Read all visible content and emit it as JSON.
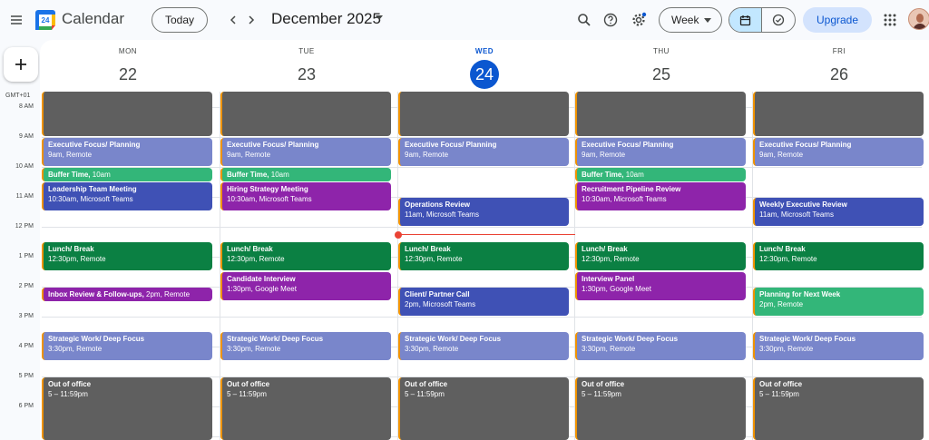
{
  "header": {
    "app_title": "Calendar",
    "logo_text": "24",
    "today_label": "Today",
    "current_date": "December 2025",
    "view_label": "Week",
    "upgrade_label": "Upgrade"
  },
  "icons": {
    "menu": "hamburger-menu-icon",
    "prev": "chevron-left-icon",
    "next": "chevron-right-icon",
    "search": "search-icon",
    "help": "help-icon",
    "settings": "gear-icon",
    "calendar_view": "calendar-icon",
    "tasks": "check-circle-icon",
    "apps": "apps-grid-icon",
    "create": "plus-icon"
  },
  "colors": {
    "accent": "#0b57d0",
    "now_line": "#ea4335",
    "event_border": "#f09300"
  },
  "timezone": "GMT+01",
  "days": [
    {
      "dow": "MON",
      "num": "22"
    },
    {
      "dow": "TUE",
      "num": "23"
    },
    {
      "dow": "WED",
      "num": "24",
      "today": true
    },
    {
      "dow": "THU",
      "num": "25"
    },
    {
      "dow": "FRI",
      "num": "26"
    }
  ],
  "hours": [
    "8 AM",
    "9 AM",
    "10 AM",
    "11 AM",
    "12 PM",
    "1 PM",
    "2 PM",
    "3 PM",
    "4 PM",
    "5 PM",
    "6 PM"
  ],
  "events": [
    {
      "day": 0,
      "start": 7.5,
      "end": 9,
      "title": "",
      "sub": "",
      "color": "#5f5f5f"
    },
    {
      "day": 0,
      "start": 9,
      "end": 10,
      "title": "Executive Focus/ Planning",
      "sub": "9am, Remote",
      "color": "#7986cb"
    },
    {
      "day": 0,
      "start": 10,
      "end": 10.5,
      "title": "Buffer Time,",
      "sub": "10am",
      "color": "#33b679",
      "inline": true
    },
    {
      "day": 0,
      "start": 10.5,
      "end": 11.5,
      "title": "Leadership Team Meeting",
      "sub": "10:30am, Microsoft Teams",
      "color": "#3f51b5"
    },
    {
      "day": 0,
      "start": 12.5,
      "end": 13.5,
      "title": "Lunch/ Break",
      "sub": "12:30pm, Remote",
      "color": "#0b8043"
    },
    {
      "day": 0,
      "start": 14,
      "end": 14.5,
      "title": "Inbox Review & Follow-ups,",
      "sub": "2pm, Remote",
      "color": "#8e24aa",
      "inline": true
    },
    {
      "day": 0,
      "start": 15.5,
      "end": 16.5,
      "title": "Strategic Work/ Deep Focus",
      "sub": "3:30pm, Remote",
      "color": "#7986cb"
    },
    {
      "day": 0,
      "start": 17,
      "end": 19.2,
      "title": "Out of office",
      "sub": "5 – 11:59pm",
      "color": "#5f5f5f"
    },
    {
      "day": 1,
      "start": 7.5,
      "end": 9,
      "title": "",
      "sub": "",
      "color": "#5f5f5f"
    },
    {
      "day": 1,
      "start": 9,
      "end": 10,
      "title": "Executive Focus/ Planning",
      "sub": "9am, Remote",
      "color": "#7986cb"
    },
    {
      "day": 1,
      "start": 10,
      "end": 10.5,
      "title": "Buffer Time,",
      "sub": "10am",
      "color": "#33b679",
      "inline": true
    },
    {
      "day": 1,
      "start": 10.5,
      "end": 11.5,
      "title": "Hiring Strategy Meeting",
      "sub": "10:30am, Microsoft Teams",
      "color": "#8e24aa"
    },
    {
      "day": 1,
      "start": 12.5,
      "end": 13.5,
      "title": "Lunch/ Break",
      "sub": "12:30pm, Remote",
      "color": "#0b8043"
    },
    {
      "day": 1,
      "start": 13.5,
      "end": 14.5,
      "title": "Candidate Interview",
      "sub": "1:30pm, Google Meet",
      "color": "#8e24aa"
    },
    {
      "day": 1,
      "start": 15.5,
      "end": 16.5,
      "title": "Strategic Work/ Deep Focus",
      "sub": "3:30pm, Remote",
      "color": "#7986cb"
    },
    {
      "day": 1,
      "start": 17,
      "end": 19.2,
      "title": "Out of office",
      "sub": "5 – 11:59pm",
      "color": "#5f5f5f"
    },
    {
      "day": 2,
      "start": 7.5,
      "end": 9,
      "title": "",
      "sub": "",
      "color": "#5f5f5f"
    },
    {
      "day": 2,
      "start": 9,
      "end": 10,
      "title": "Executive Focus/ Planning",
      "sub": "9am, Remote",
      "color": "#7986cb"
    },
    {
      "day": 2,
      "start": 11,
      "end": 12,
      "title": "Operations Review",
      "sub": "11am, Microsoft Teams",
      "color": "#3f51b5"
    },
    {
      "day": 2,
      "start": 12.5,
      "end": 13.5,
      "title": "Lunch/ Break",
      "sub": "12:30pm, Remote",
      "color": "#0b8043"
    },
    {
      "day": 2,
      "start": 14,
      "end": 15,
      "title": "Client/ Partner Call",
      "sub": "2pm, Microsoft Teams",
      "color": "#3f51b5"
    },
    {
      "day": 2,
      "start": 15.5,
      "end": 16.5,
      "title": "Strategic Work/ Deep Focus",
      "sub": "3:30pm, Remote",
      "color": "#7986cb"
    },
    {
      "day": 2,
      "start": 17,
      "end": 19.2,
      "title": "Out of office",
      "sub": "5 – 11:59pm",
      "color": "#5f5f5f"
    },
    {
      "day": 3,
      "start": 7.5,
      "end": 9,
      "title": "",
      "sub": "",
      "color": "#5f5f5f"
    },
    {
      "day": 3,
      "start": 9,
      "end": 10,
      "title": "Executive Focus/ Planning",
      "sub": "9am, Remote",
      "color": "#7986cb"
    },
    {
      "day": 3,
      "start": 10,
      "end": 10.5,
      "title": "Buffer Time,",
      "sub": "10am",
      "color": "#33b679",
      "inline": true
    },
    {
      "day": 3,
      "start": 10.5,
      "end": 11.5,
      "title": "Recruitment Pipeline Review",
      "sub": "10:30am, Microsoft Teams",
      "color": "#8e24aa"
    },
    {
      "day": 3,
      "start": 12.5,
      "end": 13.5,
      "title": "Lunch/ Break",
      "sub": "12:30pm, Remote",
      "color": "#0b8043"
    },
    {
      "day": 3,
      "start": 13.5,
      "end": 14.5,
      "title": "Interview Panel",
      "sub": "1:30pm, Google Meet",
      "color": "#8e24aa"
    },
    {
      "day": 3,
      "start": 15.5,
      "end": 16.5,
      "title": "Strategic Work/ Deep Focus",
      "sub": "3:30pm, Remote",
      "color": "#7986cb"
    },
    {
      "day": 3,
      "start": 17,
      "end": 19.2,
      "title": "Out of office",
      "sub": "5 – 11:59pm",
      "color": "#5f5f5f"
    },
    {
      "day": 4,
      "start": 7.5,
      "end": 9,
      "title": "",
      "sub": "",
      "color": "#5f5f5f"
    },
    {
      "day": 4,
      "start": 9,
      "end": 10,
      "title": "Executive Focus/ Planning",
      "sub": "9am, Remote",
      "color": "#7986cb"
    },
    {
      "day": 4,
      "start": 11,
      "end": 12,
      "title": "Weekly Executive Review",
      "sub": "11am, Microsoft Teams",
      "color": "#3f51b5"
    },
    {
      "day": 4,
      "start": 12.5,
      "end": 13.5,
      "title": "Lunch/ Break",
      "sub": "12:30pm, Remote",
      "color": "#0b8043"
    },
    {
      "day": 4,
      "start": 14,
      "end": 15,
      "title": "Planning for Next Week",
      "sub": "2pm, Remote",
      "color": "#33b679"
    },
    {
      "day": 4,
      "start": 15.5,
      "end": 16.5,
      "title": "Strategic Work/ Deep Focus",
      "sub": "3:30pm, Remote",
      "color": "#7986cb"
    },
    {
      "day": 4,
      "start": 17,
      "end": 19.2,
      "title": "Out of office",
      "sub": "5 – 11:59pm",
      "color": "#5f5f5f"
    }
  ]
}
